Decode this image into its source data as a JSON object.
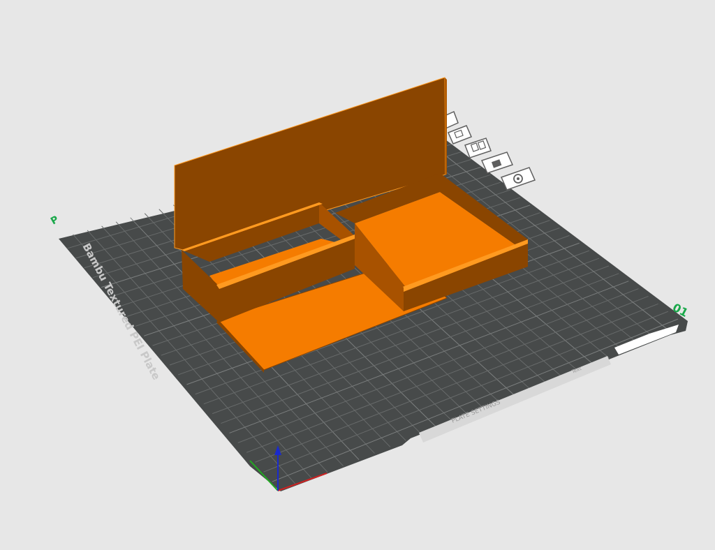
{
  "viewport": {
    "background": "#e7e7e7"
  },
  "plate": {
    "name": "Bambu Textured PEI Plate",
    "color": "#474a4a",
    "grid_color": "#6a6d6d",
    "number": "01",
    "model_label": "PLATE SETTINGS",
    "sub_label": "Text",
    "corner_mark": "P"
  },
  "plate_toolbar": {
    "icons": [
      "arrange-icon",
      "orient-icon",
      "layout-icon",
      "lock-icon",
      "settings-icon"
    ],
    "color": "#5f5f5f"
  },
  "model": {
    "color_light": "#f57c00",
    "color_dark": "#8a4500",
    "parts": [
      "tray-base",
      "small-box",
      "large-box",
      "back-panel"
    ]
  },
  "axes": {
    "x_color": "#cc2222",
    "y_color": "#22aa22",
    "z_color": "#1a2acc"
  }
}
